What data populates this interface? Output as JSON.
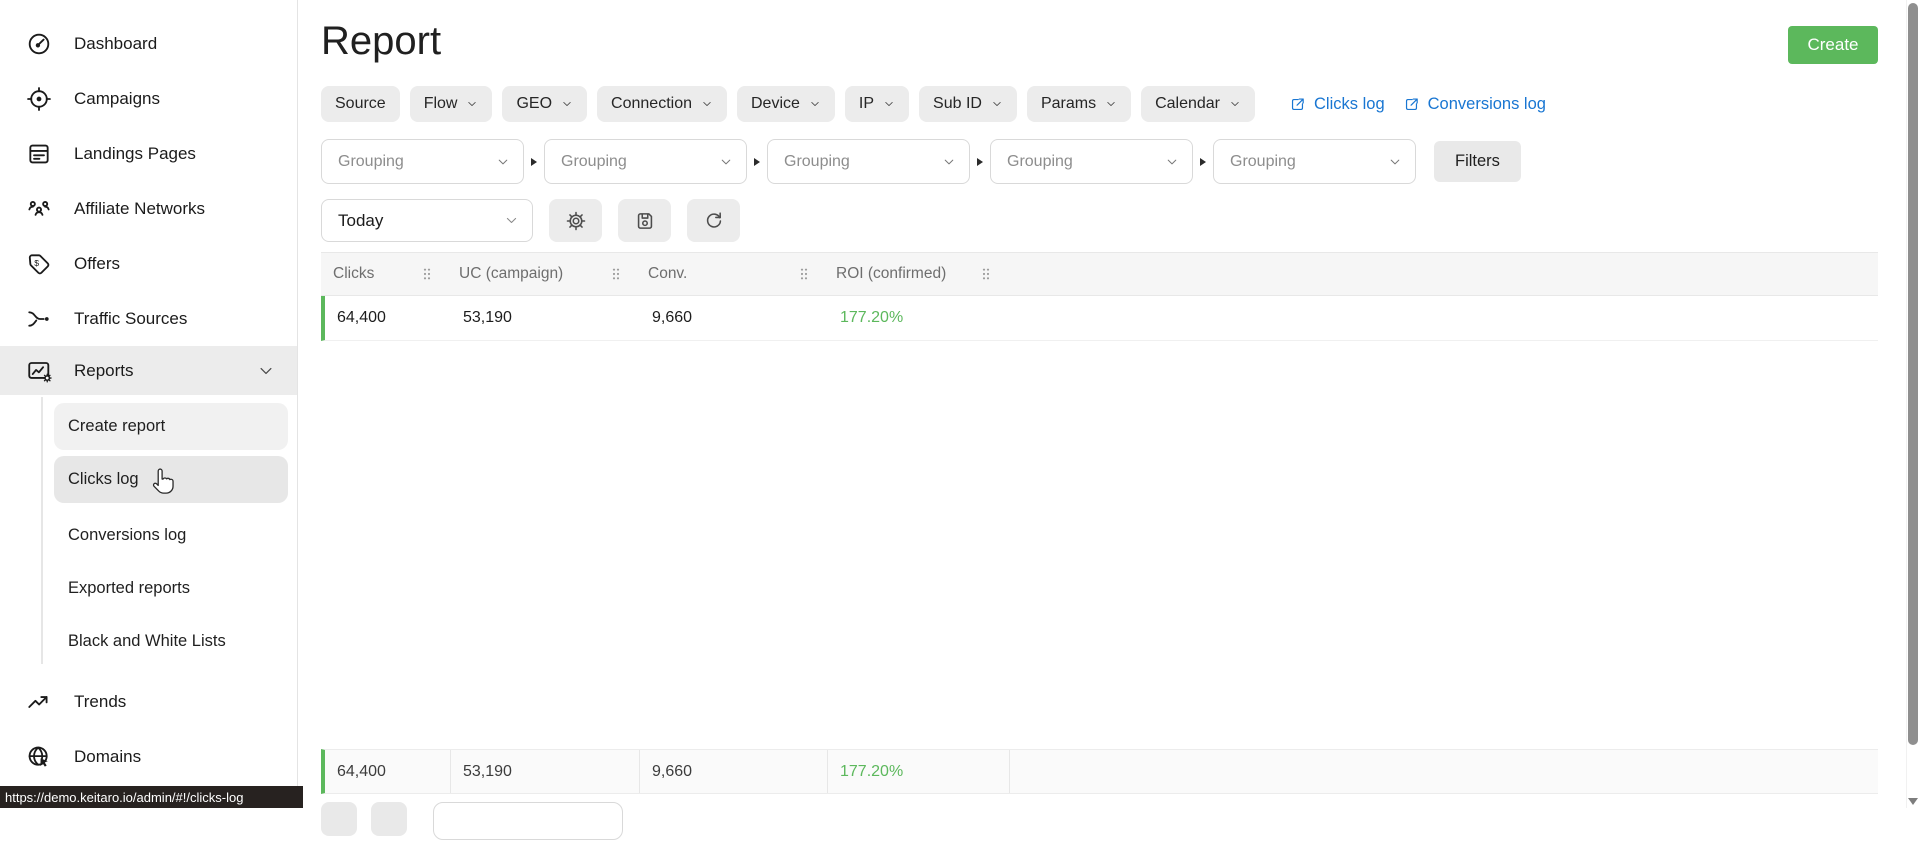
{
  "header": {
    "title": "Report",
    "create_button": "Create"
  },
  "sidebar": {
    "items": [
      {
        "id": "dashboard",
        "label": "Dashboard",
        "icon": "dashboard-icon"
      },
      {
        "id": "campaigns",
        "label": "Campaigns",
        "icon": "campaigns-icon"
      },
      {
        "id": "landing-pages",
        "label": "Landings Pages",
        "icon": "landing-pages-icon"
      },
      {
        "id": "affiliate-networks",
        "label": "Affiliate Networks",
        "icon": "affiliate-networks-icon"
      },
      {
        "id": "offers",
        "label": "Offers",
        "icon": "offers-icon"
      },
      {
        "id": "traffic-sources",
        "label": "Traffic Sources",
        "icon": "traffic-sources-icon"
      },
      {
        "id": "reports",
        "label": "Reports",
        "icon": "reports-icon",
        "active": true,
        "expanded": true
      },
      {
        "id": "trends",
        "label": "Trends",
        "icon": "trends-icon"
      },
      {
        "id": "domains",
        "label": "Domains",
        "icon": "domains-icon"
      }
    ],
    "reports_submenu": [
      {
        "id": "create-report",
        "label": "Create report",
        "highlight": "light"
      },
      {
        "id": "clicks-log",
        "label": "Clicks log",
        "highlight": "hover"
      },
      {
        "id": "conversions-log",
        "label": "Conversions log"
      },
      {
        "id": "exported-reports",
        "label": "Exported reports"
      },
      {
        "id": "black-and-white-lists",
        "label": "Black and White Lists"
      }
    ]
  },
  "filters": {
    "chips": [
      {
        "label": "Source",
        "chevron": false
      },
      {
        "label": "Flow",
        "chevron": true
      },
      {
        "label": "GEO",
        "chevron": true
      },
      {
        "label": "Connection",
        "chevron": true
      },
      {
        "label": "Device",
        "chevron": true
      },
      {
        "label": "IP",
        "chevron": true
      },
      {
        "label": "Sub ID",
        "chevron": true
      },
      {
        "label": "Params",
        "chevron": true
      },
      {
        "label": "Calendar",
        "chevron": true
      }
    ],
    "log_links": [
      {
        "label": "Clicks log"
      },
      {
        "label": "Conversions log"
      }
    ],
    "grouping_selects": [
      {
        "placeholder": "Grouping"
      },
      {
        "placeholder": "Grouping"
      },
      {
        "placeholder": "Grouping"
      },
      {
        "placeholder": "Grouping"
      },
      {
        "placeholder": "Grouping"
      }
    ],
    "filters_button": "Filters"
  },
  "toolbar": {
    "date_range": "Today",
    "buttons": [
      {
        "icon": "gear-icon"
      },
      {
        "icon": "save-icon"
      },
      {
        "icon": "refresh-icon"
      }
    ]
  },
  "table": {
    "columns": [
      "Clicks",
      "UC (campaign)",
      "Conv.",
      "ROI (confirmed)"
    ],
    "rows": [
      [
        "64,400",
        "53,190",
        "9,660",
        "177.20%"
      ]
    ],
    "totals": [
      "64,400",
      "53,190",
      "9,660",
      "177.20%"
    ]
  },
  "statusbar": {
    "url": "https://demo.keitaro.io/admin/#!/clicks-log"
  },
  "colors": {
    "accent_green": "#5cb85c",
    "link_blue": "#1976d2"
  }
}
